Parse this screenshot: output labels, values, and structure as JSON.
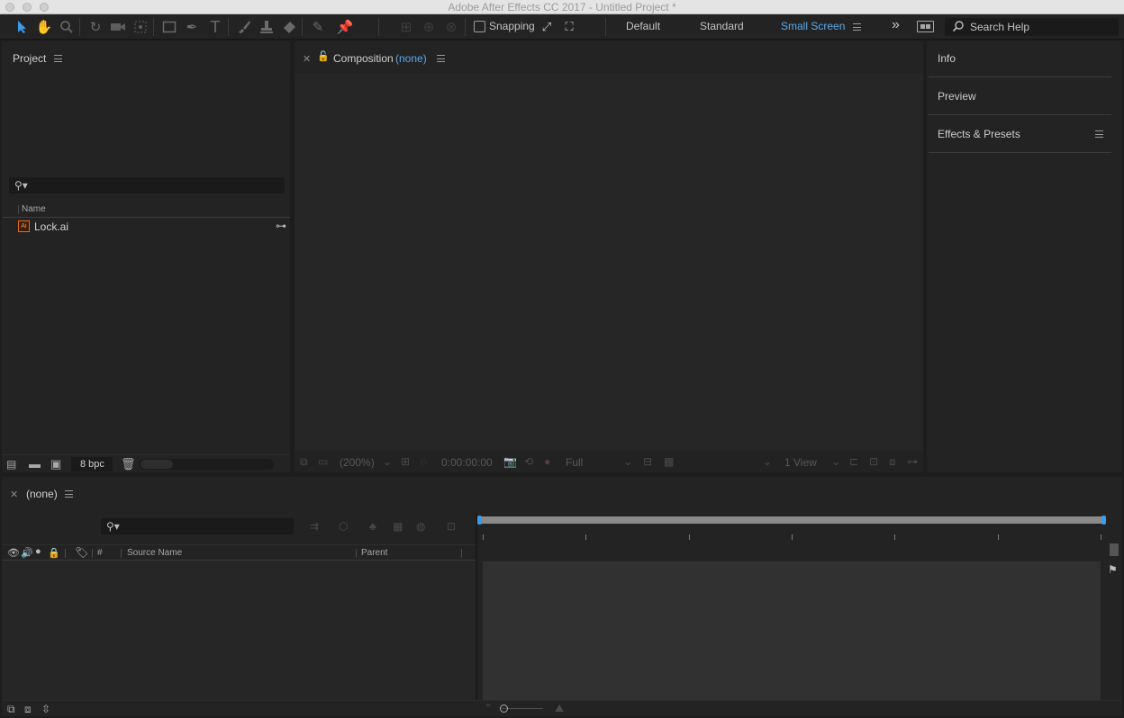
{
  "window": {
    "title": "Adobe After Effects CC 2017 - Untitled Project *"
  },
  "toolbar": {
    "tools": [
      "selection-tool-icon",
      "hand-tool-icon",
      "zoom-tool-icon",
      "rotate-tool-icon",
      "camera-tool-icon",
      "pan-behind-icon",
      "rectangle-tool-icon",
      "pen-tool-icon",
      "type-tool-icon",
      "brush-tool-icon",
      "clone-stamp-icon",
      "eraser-icon",
      "roto-brush-icon",
      "puppet-pin-icon"
    ],
    "snapping_label": "Snapping",
    "workspaces": [
      "Default",
      "Standard",
      "Small Screen"
    ],
    "active_workspace": "Small Screen",
    "more_glyph": "»",
    "search_placeholder": "Search Help"
  },
  "project_panel": {
    "title": "Project",
    "column_name": "Name",
    "items": [
      {
        "name": "Lock.ai",
        "icon": "ai-file-icon"
      }
    ],
    "bpc_label": "8 bpc"
  },
  "composition_panel": {
    "title": "Composition",
    "comp_name": "(none)",
    "footer": {
      "magnification": "(200%)",
      "timecode": "0:00:00:00",
      "resolution": "Full",
      "views": "1 View"
    }
  },
  "right_panels": {
    "items": [
      "Info",
      "Preview",
      "Effects & Presets"
    ]
  },
  "timeline_panel": {
    "title": "(none)",
    "columns": {
      "number": "#",
      "source_name": "Source Name",
      "parent": "Parent"
    }
  },
  "colors": {
    "accent": "#3d9be9",
    "panel_bg": "#232323",
    "frame_bg": "#1d1d1d",
    "work_area_bar": "#8a8a8a",
    "timeline_track_bg": "#313131"
  }
}
